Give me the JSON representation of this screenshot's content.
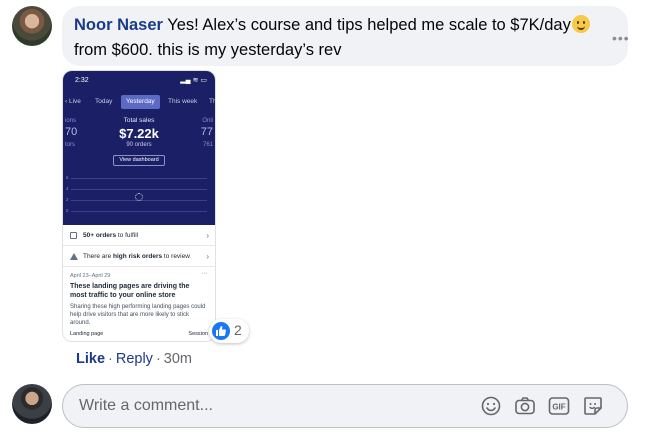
{
  "comment": {
    "author": "Noor Naser",
    "text_before_emoji": "Yes! Alex’s course and tips helped me scale to $7K/day",
    "text_after_emoji": " from $600. this is my yesterday’s rev",
    "more_label": "•••"
  },
  "screenshot": {
    "status_time": "2:32",
    "tabs": [
      "Live",
      "Today",
      "Yesterday",
      "This week",
      "Th"
    ],
    "active_tab": "Yesterday",
    "side_left": [
      "ions",
      "70",
      "tors"
    ],
    "side_right": [
      "Onli",
      "77",
      "761"
    ],
    "sales_label": "Total sales",
    "sales_value": "$7.22k",
    "sales_orders": "90 orders",
    "view_dashboard": "View dashboard",
    "grid_labels": [
      "6",
      "4",
      "2",
      "0"
    ],
    "row1_bold": "50+ orders",
    "row1_rest": " to fulfill",
    "row2_pre": "There are ",
    "row2_bold": "high risk orders",
    "row2_rest": " to review",
    "card_date": "April 23–April 29",
    "card_title": "These landing pages are driving the most traffic to your online store",
    "card_body": "Sharing these high performing landing pages could help drive visitors that are more likely to stick around.",
    "card_foot_left": "Landing page",
    "card_foot_right": "Session"
  },
  "reaction": {
    "count": "2"
  },
  "actions": {
    "like": "Like",
    "reply": "Reply",
    "time": "30m",
    "separator": "·"
  },
  "composer": {
    "placeholder": "Write a comment..."
  },
  "icons": [
    "smiley-icon",
    "camera-icon",
    "gif-icon",
    "sticker-icon",
    "like-thumb-icon"
  ],
  "colors": {
    "author": "#1c3a8a",
    "dashboard_bg": "#1a1f66",
    "bubble_bg": "#f0f2f5",
    "like_blue": "#1877f2"
  }
}
